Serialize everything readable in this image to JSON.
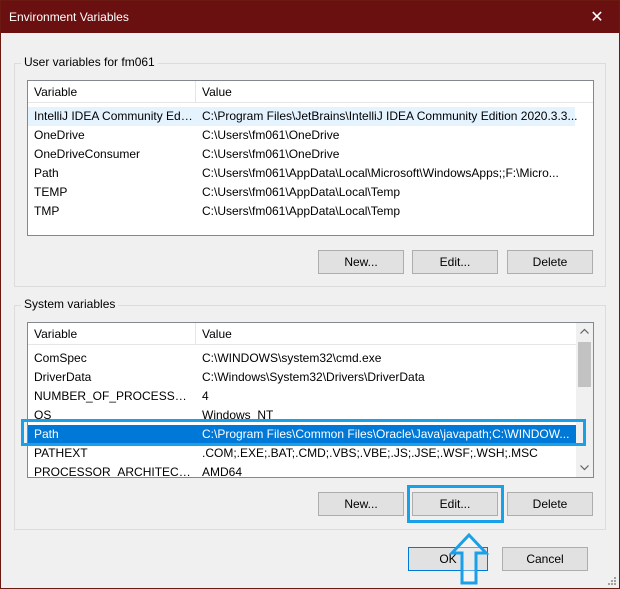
{
  "window": {
    "title": "Environment Variables",
    "close_glyph": "✕"
  },
  "user_vars": {
    "group_label": "User variables for fm061",
    "columns": [
      "Variable",
      "Value"
    ],
    "rows": [
      {
        "name": "IntelliJ IDEA Community Editi...",
        "value": "C:\\Program Files\\JetBrains\\IntelliJ IDEA Community Edition 2020.3.3..."
      },
      {
        "name": "OneDrive",
        "value": "C:\\Users\\fm061\\OneDrive"
      },
      {
        "name": "OneDriveConsumer",
        "value": "C:\\Users\\fm061\\OneDrive"
      },
      {
        "name": "Path",
        "value": "C:\\Users\\fm061\\AppData\\Local\\Microsoft\\WindowsApps;;F:\\Micro..."
      },
      {
        "name": "TEMP",
        "value": "C:\\Users\\fm061\\AppData\\Local\\Temp"
      },
      {
        "name": "TMP",
        "value": "C:\\Users\\fm061\\AppData\\Local\\Temp"
      }
    ],
    "buttons": {
      "new": "New...",
      "edit": "Edit...",
      "delete": "Delete"
    }
  },
  "system_vars": {
    "group_label": "System variables",
    "columns": [
      "Variable",
      "Value"
    ],
    "rows": [
      {
        "name": "ComSpec",
        "value": "C:\\WINDOWS\\system32\\cmd.exe"
      },
      {
        "name": "DriverData",
        "value": "C:\\Windows\\System32\\Drivers\\DriverData"
      },
      {
        "name": "NUMBER_OF_PROCESSORS",
        "value": "4"
      },
      {
        "name": "OS",
        "value": "Windows_NT"
      },
      {
        "name": "Path",
        "value": "C:\\Program Files\\Common Files\\Oracle\\Java\\javapath;C:\\WINDOW..."
      },
      {
        "name": "PATHEXT",
        "value": ".COM;.EXE;.BAT;.CMD;.VBS;.VBE;.JS;.JSE;.WSF;.WSH;.MSC"
      },
      {
        "name": "PROCESSOR_ARCHITECTURE",
        "value": "AMD64"
      }
    ],
    "selected_row": "Path",
    "buttons": {
      "new": "New...",
      "edit": "Edit...",
      "delete": "Delete"
    }
  },
  "dialog_buttons": {
    "ok": "OK",
    "cancel": "Cancel"
  },
  "icons": {
    "scroll_up": "chevron-up-icon",
    "scroll_down": "chevron-down-icon",
    "annotation": "up-arrow-icon"
  },
  "colors": {
    "titlebar": "#6b1010",
    "selection": "#0078d7",
    "annotation": "#1aa0e8"
  }
}
